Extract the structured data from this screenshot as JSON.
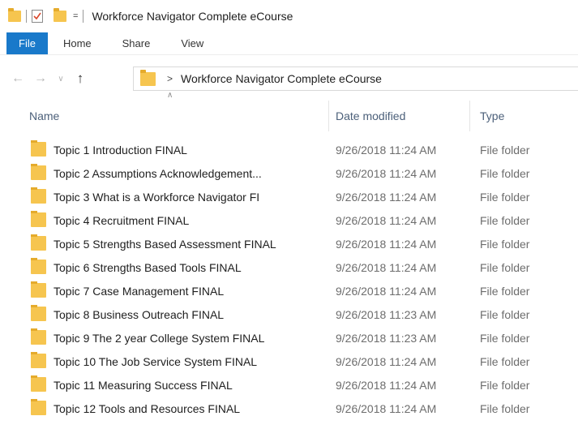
{
  "window": {
    "title": "Workforce Navigator Complete eCourse",
    "quick_access_dropdown": "="
  },
  "ribbon": {
    "tabs": [
      {
        "label": "File"
      },
      {
        "label": "Home"
      },
      {
        "label": "Share"
      },
      {
        "label": "View"
      }
    ]
  },
  "navigation": {
    "back_icon": "arrow-left-icon",
    "forward_icon": "arrow-right-icon",
    "recent_icon": "chevron-down-icon",
    "up_icon": "arrow-up-icon",
    "breadcrumb_separator": ">",
    "path": "Workforce Navigator Complete eCourse"
  },
  "columns": {
    "name": "Name",
    "date_modified": "Date modified",
    "type": "Type"
  },
  "files": [
    {
      "name": "Topic 1 Introduction FINAL",
      "date": "9/26/2018 11:24 AM",
      "type": "File folder"
    },
    {
      "name": "Topic 2 Assumptions Acknowledgement...",
      "date": "9/26/2018 11:24 AM",
      "type": "File folder"
    },
    {
      "name": "Topic 3 What is a Workforce Navigator FI",
      "date": "9/26/2018 11:24 AM",
      "type": "File folder"
    },
    {
      "name": "Topic 4 Recruitment FINAL",
      "date": "9/26/2018 11:24 AM",
      "type": "File folder"
    },
    {
      "name": "Topic 5 Strengths Based Assessment FINAL",
      "date": "9/26/2018 11:24 AM",
      "type": "File folder"
    },
    {
      "name": "Topic 6 Strengths Based Tools FINAL",
      "date": "9/26/2018 11:24 AM",
      "type": "File folder"
    },
    {
      "name": "Topic 7 Case Management FINAL",
      "date": "9/26/2018 11:24 AM",
      "type": "File folder"
    },
    {
      "name": "Topic 8 Business Outreach FINAL",
      "date": "9/26/2018 11:23 AM",
      "type": "File folder"
    },
    {
      "name": "Topic 9 The 2 year College System FINAL",
      "date": "9/26/2018 11:23 AM",
      "type": "File folder"
    },
    {
      "name": "Topic 10 The Job Service System FINAL",
      "date": "9/26/2018 11:24 AM",
      "type": "File folder"
    },
    {
      "name": "Topic 11 Measuring Success FINAL",
      "date": "9/26/2018 11:24 AM",
      "type": "File folder"
    },
    {
      "name": "Topic 12 Tools and Resources FINAL",
      "date": "9/26/2018 11:24 AM",
      "type": "File folder"
    }
  ],
  "colors": {
    "file_tab": "#1979ca",
    "folder": "#f6c54f",
    "header_text": "#4c607a"
  }
}
